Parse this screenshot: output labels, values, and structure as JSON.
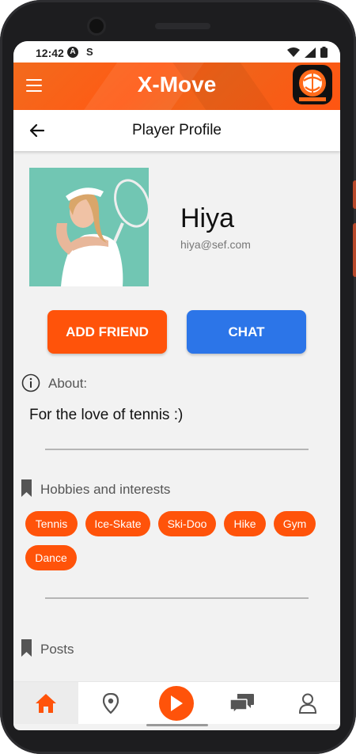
{
  "status_bar": {
    "time": "12:42",
    "a_glyph": "A",
    "s_glyph": "S"
  },
  "app_bar": {
    "title": "X-Move",
    "menu_icon": "hamburger-icon",
    "logo": "x-move-logo"
  },
  "header": {
    "title": "Player Profile",
    "back_icon": "arrow-left-icon"
  },
  "profile": {
    "name": "Hiya",
    "email": "hiya@sef.com"
  },
  "actions": {
    "add_friend": "ADD FRIEND",
    "chat": "CHAT"
  },
  "about": {
    "label": "About:",
    "text": "For the love of tennis :)"
  },
  "hobbies": {
    "label": "Hobbies and interests",
    "items": [
      "Tennis",
      "Ice-Skate",
      "Ski-Doo",
      "Hike",
      "Gym",
      "Dance"
    ]
  },
  "posts": {
    "label": "Posts"
  },
  "bottom_nav": {
    "items": [
      "home-icon",
      "location-pin-icon",
      "play-icon",
      "chat-bubbles-icon",
      "person-icon"
    ],
    "active": "home-icon"
  },
  "colors": {
    "accent": "#ff530a",
    "chat_blue": "#2c75e8",
    "background": "#f2f2f2"
  }
}
